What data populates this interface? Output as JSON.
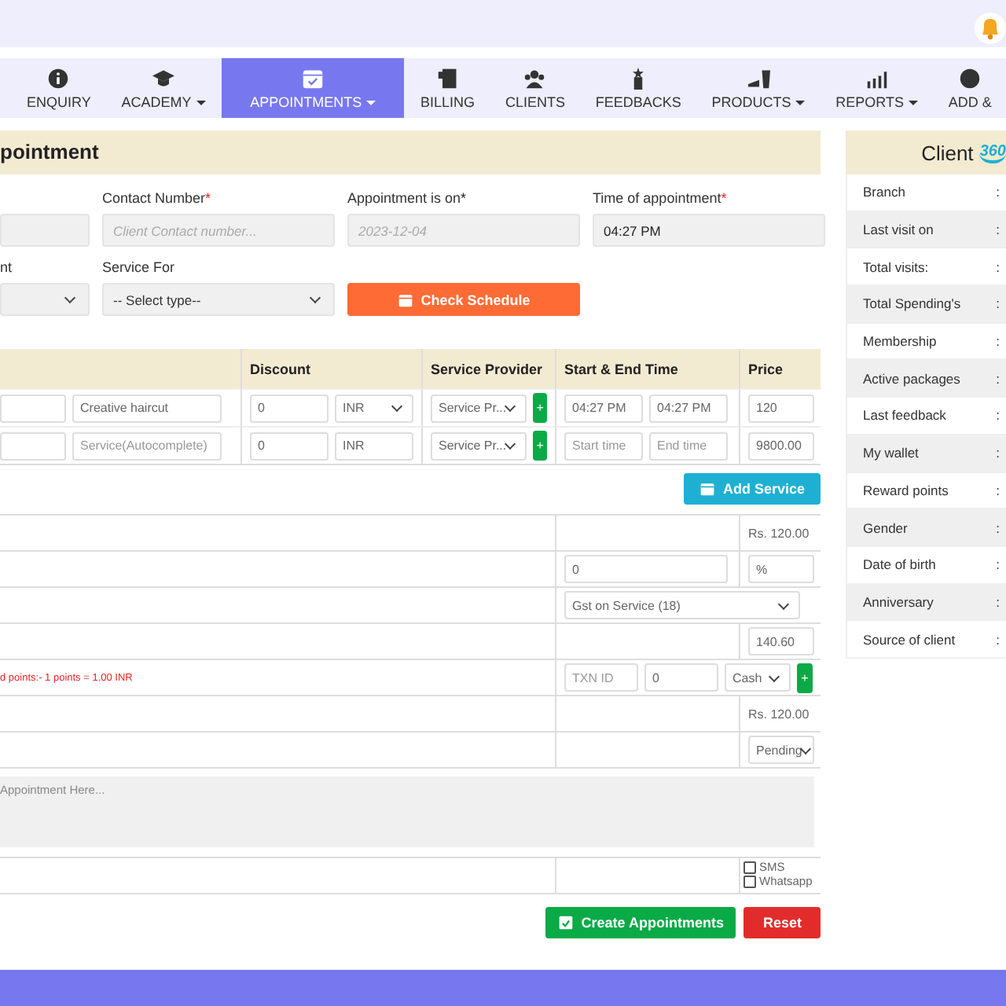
{
  "nav": [
    {
      "label": "ENQUIRY",
      "selected": false,
      "dropdown": false
    },
    {
      "label": "ACADEMY",
      "selected": false,
      "dropdown": true
    },
    {
      "label": "APPOINTMENTS",
      "selected": true,
      "dropdown": true
    },
    {
      "label": "BILLING",
      "selected": false,
      "dropdown": false
    },
    {
      "label": "CLIENTS",
      "selected": false,
      "dropdown": false
    },
    {
      "label": "FEEDBACKS",
      "selected": false,
      "dropdown": false
    },
    {
      "label": "PRODUCTS",
      "selected": false,
      "dropdown": true
    },
    {
      "label": "REPORTS",
      "selected": false,
      "dropdown": true
    },
    {
      "label": "ADD &",
      "selected": false,
      "dropdown": false
    }
  ],
  "form": {
    "title": "pointment",
    "row1": [
      {
        "kind": "input"
      },
      {
        "kind": "input",
        "label": "Contact Number",
        "star": "*",
        "star_red": true,
        "placeholder": "Client Contact number..."
      },
      {
        "kind": "input",
        "label": "Appointment is on",
        "star": "*",
        "star_red": false,
        "placeholder": "2023-12-04"
      },
      {
        "kind": "input",
        "label": "Time of appointment",
        "star": "*",
        "star_red": true,
        "value": "04:27 PM"
      }
    ],
    "row2": [
      {
        "label": "nt",
        "kind": "select"
      },
      {
        "label": "Service For",
        "kind": "select",
        "value": "-- Select type--"
      },
      {
        "kind": "button",
        "value": "Check Schedule"
      }
    ]
  },
  "services": {
    "columns": [
      "Discount",
      "Service Provider",
      "Start & End Time",
      "Price"
    ],
    "rows": [
      {
        "service": "Creative haircut",
        "discount": "0",
        "currency": "INR",
        "currency_dropdown": true,
        "provider": "Service Pr...",
        "add": "+",
        "start": "04:27 PM",
        "end": "04:27 PM",
        "price": "120"
      },
      {
        "service_placeholder": "Service(Autocomplete)",
        "discount": "0",
        "currency": "INR",
        "currency_dropdown": false,
        "provider": "Service Pr...",
        "add": "+",
        "start_placeholder": "Start time",
        "end_placeholder": "End time",
        "price": "9800.00"
      }
    ],
    "add_button": "Add Service"
  },
  "summary": [
    {
      "kind": "amount",
      "value": "Rs. 120.00"
    },
    {
      "kind": "discount",
      "value": "0",
      "unit": "%"
    },
    {
      "kind": "tax",
      "value": "Gst on Service (18)"
    },
    {
      "kind": "total",
      "value": "140.60"
    },
    {
      "kind": "payment",
      "note": "d points:- 1 points = 1.00 INR",
      "txn_placeholder": "TXN ID",
      "amount": "0",
      "method": "Cash",
      "add": "+"
    },
    {
      "kind": "amount",
      "value": "Rs. 120.00"
    },
    {
      "kind": "status",
      "value": "Pending"
    }
  ],
  "notes_placeholder": "Appointment Here...",
  "notify": [
    {
      "label": "SMS",
      "checked": false
    },
    {
      "label": "Whatsapp",
      "checked": false
    }
  ],
  "buttons": {
    "create": "Create Appointments",
    "reset": "Reset"
  },
  "client": {
    "title": "Client",
    "logo": "360",
    "rows": [
      "Branch",
      "Last visit on",
      "Total visits:",
      "Total Spending's",
      "Membership",
      "Active packages",
      "Last feedback",
      "My wallet",
      "Reward points",
      "Gender",
      "Date of birth",
      "Anniversary",
      "Source of client"
    ],
    "separator": ":"
  }
}
